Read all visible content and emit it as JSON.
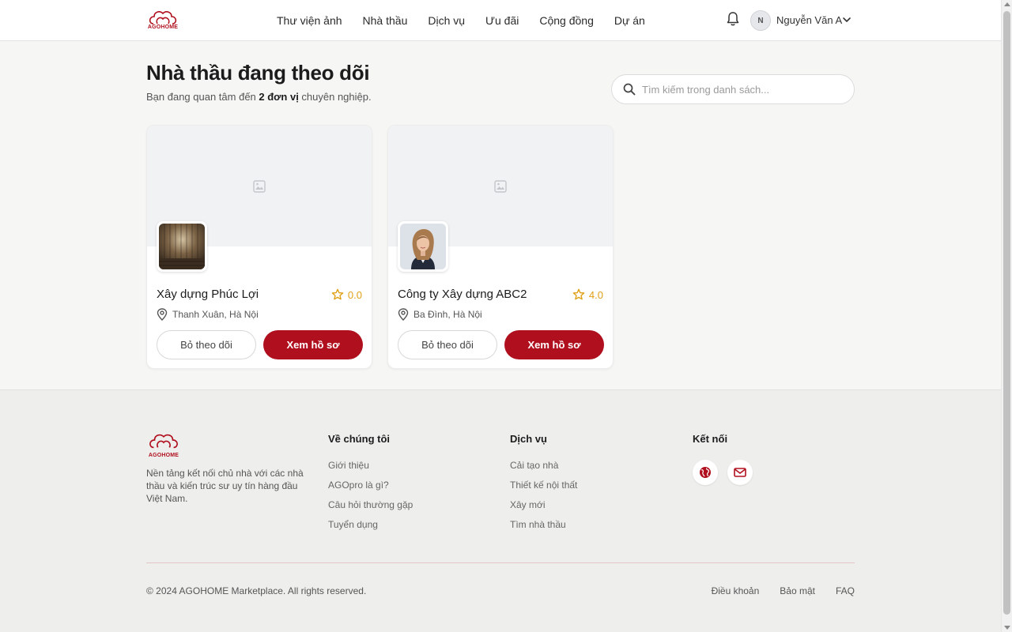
{
  "header": {
    "logo_text": "AGOHOME",
    "nav": [
      "Thư viện ảnh",
      "Nhà thầu",
      "Dịch vụ",
      "Ưu đãi",
      "Cộng đồng",
      "Dự án"
    ],
    "user": {
      "initial": "N",
      "name": "Nguyễn Văn A"
    }
  },
  "page": {
    "title": "Nhà thầu đang theo dõi",
    "subtitle_prefix": "Bạn đang quan tâm đến ",
    "subtitle_count": "2 đơn vị",
    "subtitle_suffix": " chuyên nghiệp.",
    "search_placeholder": "Tìm kiếm trong danh sách..."
  },
  "contractors": [
    {
      "name": "Xây dựng Phúc Lợi",
      "rating": "0.0",
      "location": "Thanh Xuân, Hà Nội",
      "unfollow_label": "Bỏ theo dõi",
      "view_label": "Xem hồ sơ"
    },
    {
      "name": "Công ty Xây dựng ABC2",
      "rating": "4.0",
      "location": "Ba Đình, Hà Nội",
      "unfollow_label": "Bỏ theo dõi",
      "view_label": "Xem hồ sơ"
    }
  ],
  "footer": {
    "logo_text": "AGOHOME",
    "description": "Nền tảng kết nối chủ nhà với các nhà thầu và kiến trúc sư uy tín hàng đầu Việt Nam.",
    "columns": [
      {
        "title": "Về chúng tôi",
        "links": [
          "Giới thiệu",
          "AGOpro là gì?",
          "Câu hỏi thường gặp",
          "Tuyển dụng"
        ]
      },
      {
        "title": "Dịch vụ",
        "links": [
          "Cải tạo nhà",
          "Thiết kế nội thất",
          "Xây mới",
          "Tìm nhà thầu"
        ]
      }
    ],
    "connect_title": "Kết nối",
    "social_icons": [
      "globe-icon",
      "mail-icon"
    ],
    "copyright": "© 2024 AGOHOME Marketplace. All rights reserved.",
    "legal": [
      "Điều khoản",
      "Bảo mật",
      "FAQ"
    ]
  },
  "colors": {
    "brand": "#b0101e",
    "star": "#e0a018",
    "background": "#f6f6f4"
  }
}
